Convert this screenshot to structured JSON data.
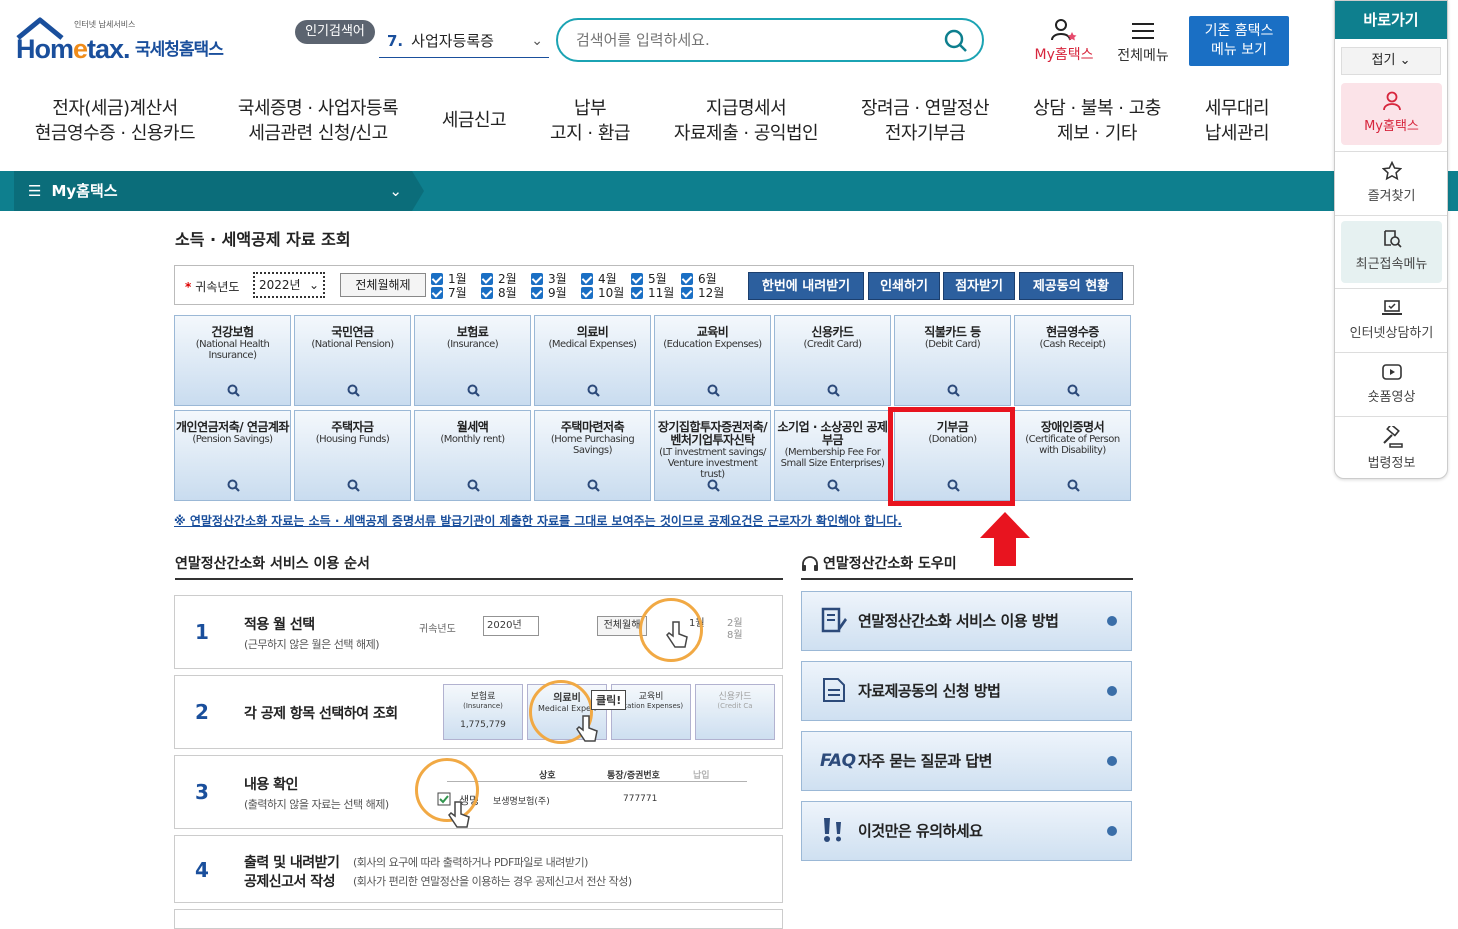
{
  "header": {
    "logo_small": "인터넷 납세서비스",
    "logo_name_1": "Hom",
    "logo_name_2": "e",
    "logo_name_3": "tax.",
    "logo_kr": "국세청홈택스",
    "popular_label": "인기검색어",
    "popular_num": "7.",
    "popular_term": "사업자등록증",
    "search_placeholder": "검색어를 입력하세요.",
    "my_label": "My홈택스",
    "allmenu_label": "전체메뉴",
    "old_btn_line1": "기존 홈택스",
    "old_btn_line2": "메뉴 보기"
  },
  "gnb": [
    {
      "l1": "전자(세금)계산서",
      "l2": "현금영수증 · 신용카드"
    },
    {
      "l1": "국세증명 · 사업자등록",
      "l2": "세금관련 신청/신고"
    },
    {
      "l1": "세금신고",
      "l2": ""
    },
    {
      "l1": "납부",
      "l2": "고지 · 환급"
    },
    {
      "l1": "지급명세서",
      "l2": "자료제출 · 공익법인"
    },
    {
      "l1": "장려금 · 연말정산",
      "l2": "전자기부금"
    },
    {
      "l1": "상담 · 불복 · 고충",
      "l2": "제보 · 기타"
    },
    {
      "l1": "세무대리",
      "l2": "납세관리"
    }
  ],
  "subbar": {
    "menu_label": "My홈택스"
  },
  "page": {
    "title": "소득 · 세액공제 자료 조회",
    "filter": {
      "year_label": "귀속년도",
      "year_value": "2022년",
      "all_unselect": "전체월해제",
      "months": [
        "1월",
        "2월",
        "3월",
        "4월",
        "5월",
        "6월",
        "7월",
        "8월",
        "9월",
        "10월",
        "11월",
        "12월"
      ],
      "buttons": [
        "한번에 내려받기",
        "인쇄하기",
        "점자받기",
        "제공동의 현황"
      ]
    },
    "categories": [
      {
        "t": "건강보험",
        "e": "(National Health Insurance)"
      },
      {
        "t": "국민연금",
        "e": "(National Pension)"
      },
      {
        "t": "보험료",
        "e": "(Insurance)"
      },
      {
        "t": "의료비",
        "e": "(Medical Expenses)"
      },
      {
        "t": "교육비",
        "e": "(Education Expenses)"
      },
      {
        "t": "신용카드",
        "e": "(Credit Card)"
      },
      {
        "t": "직불카드 등",
        "e": "(Debit Card)"
      },
      {
        "t": "현금영수증",
        "e": "(Cash Receipt)"
      },
      {
        "t": "개인연금저축/ 연금계좌",
        "e": "(Pension Savings)"
      },
      {
        "t": "주택자금",
        "e": "(Housing Funds)"
      },
      {
        "t": "월세액",
        "e": "(Monthly rent)"
      },
      {
        "t": "주택마련저축",
        "e": "(Home Purchasing Savings)"
      },
      {
        "t": "장기집합투자증권저축/ 벤처기업투자신탁",
        "e": "(LT investment savings/ Venture investment trust)"
      },
      {
        "t": "소기업 · 소상공인 공제부금",
        "e": "(Membership Fee For Small Size Enterprises)"
      },
      {
        "t": "기부금",
        "e": "(Donation)"
      },
      {
        "t": "장애인증명서",
        "e": "(Certificate of Person with Disability)"
      }
    ],
    "notice": "※ 연말정산간소화 자료는 소득 · 세액공제 증명서류 발급기관이 제출한 자료를 그대로 보여주는 것이므로 공제요건은 근로자가 확인해야 합니다.",
    "steps_title": "연말정산간소화 서비스 이용 순서",
    "steps": [
      {
        "n": "1",
        "h": "적용 월 선택",
        "s": "(근무하지 않은 월은 선택 해제)"
      },
      {
        "n": "2",
        "h": "각 공제 항목 선택하여 조회",
        "s": ""
      },
      {
        "n": "3",
        "h": "내용 확인",
        "s": "(출력하지 않을 자료는 선택 해제)"
      },
      {
        "n": "4",
        "h": "출력 및 내려받기",
        "h2": "공제신고서 작성",
        "s": "(회사의 요구에 따라 출력하거나 PDF파일로 내려받기)",
        "s2": "(회사가 편리한 연말정산을 이용하는 경우 공제신고서 전산 작성)"
      }
    ],
    "step_ill": {
      "s1_year_label": "귀속년도",
      "s1_year": "2020년",
      "s1_all": "전체월해",
      "s1_m1": "1월",
      "s1_m2": "2월",
      "s1_m8": "8월",
      "s2_c1": "보험료",
      "s2_c1e": "(Insurance)",
      "s2_c1v": "1,775,779",
      "s2_c2": "의료비",
      "s2_c2e": "Medical Expen",
      "s2_click": "클릭!",
      "s2_c3": "교육비",
      "s2_c3e": "ucation Expenses)",
      "s2_c4": "신용카드",
      "s2_c4e": "(Credit Ca",
      "s3_h1": "상호",
      "s3_h2": "통장/증권번호",
      "s3_h3": "납입",
      "s3_row": "생명",
      "s3_company": "보생명보험(주)",
      "s3_num": "777771"
    },
    "helper_title": "연말정산간소화 도우미",
    "helpers": [
      "연말정산간소화 서비스 이용 방법",
      "자료제공동의 신청 방법",
      "자주 묻는 질문과 답변",
      "이것만은 유의하세요"
    ],
    "helper_faq_tag": "FAQ"
  },
  "quick": {
    "title": "바로가기",
    "fold": "접기",
    "items": [
      "My홈택스",
      "즐겨찾기",
      "최근접속메뉴",
      "인터넷상담하기",
      "숏폼영상",
      "법령정보"
    ]
  },
  "colors": {
    "teal": "#0e7f8e",
    "blue": "#1a4f9c",
    "highlight": "#e8141f"
  }
}
